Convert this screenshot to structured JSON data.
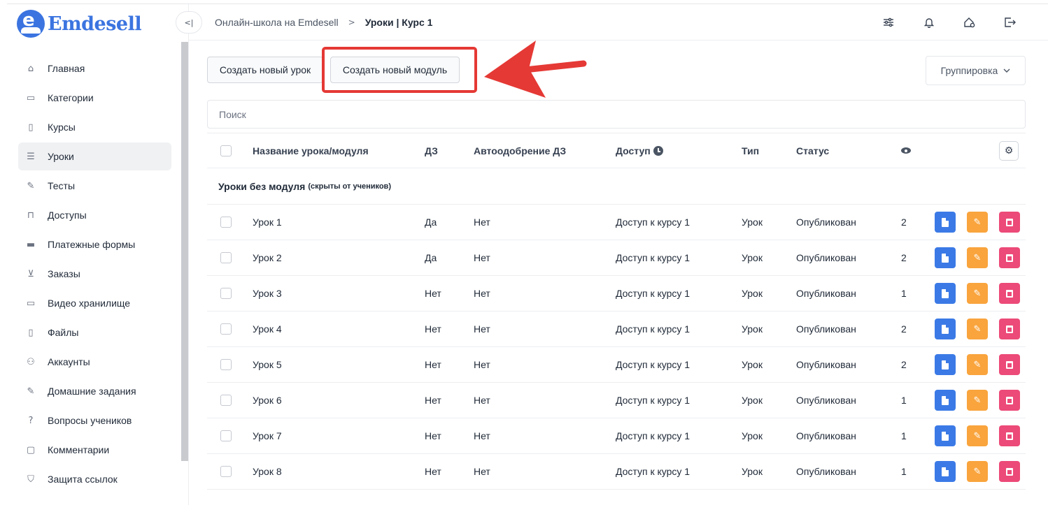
{
  "app": {
    "name": "Emdesell",
    "logo_letter": "e"
  },
  "header": {
    "breadcrumb": [
      "Онлайн-школа на Emdesell",
      "Уроки | Курс 1"
    ],
    "icons": [
      "sliders-icon",
      "bell-icon",
      "home-settings-icon",
      "logout-icon"
    ]
  },
  "sidebar": {
    "items": [
      {
        "label": "Главная",
        "icon": "home-icon",
        "glyph": "⌂"
      },
      {
        "label": "Категории",
        "icon": "folder-icon",
        "glyph": "▭"
      },
      {
        "label": "Курсы",
        "icon": "book-icon",
        "glyph": "▯"
      },
      {
        "label": "Уроки",
        "icon": "list-icon",
        "glyph": "☰",
        "active": true
      },
      {
        "label": "Тесты",
        "icon": "edit-icon",
        "glyph": "✎"
      },
      {
        "label": "Доступы",
        "icon": "lock-icon",
        "glyph": "⊓"
      },
      {
        "label": "Платежные формы",
        "icon": "credit-card-icon",
        "glyph": "▬"
      },
      {
        "label": "Заказы",
        "icon": "cart-icon",
        "glyph": "⊻"
      },
      {
        "label": "Видео хранилище",
        "icon": "video-icon",
        "glyph": "▭"
      },
      {
        "label": "Файлы",
        "icon": "file-icon",
        "glyph": "▯"
      },
      {
        "label": "Аккаунты",
        "icon": "users-icon",
        "glyph": "⚇"
      },
      {
        "label": "Домашние задания",
        "icon": "pencil-icon",
        "glyph": "✎"
      },
      {
        "label": "Вопросы учеников",
        "icon": "question-icon",
        "glyph": "?"
      },
      {
        "label": "Комментарии",
        "icon": "comment-icon",
        "glyph": "▢"
      },
      {
        "label": "Защита ссылок",
        "icon": "shield-icon",
        "glyph": "⛉"
      }
    ]
  },
  "toolbar": {
    "create_lesson": "Создать новый урок",
    "create_module": "Создать новый модуль",
    "grouping": "Группировка"
  },
  "search": {
    "placeholder": "Поиск"
  },
  "table": {
    "columns": {
      "name": "Название урока/модуля",
      "hw": "ДЗ",
      "auto": "Автоодобрение ДЗ",
      "access": "Доступ",
      "type": "Тип",
      "status": "Статус"
    },
    "group": {
      "title": "Уроки без модуля",
      "note": "(скрыты от учеников)"
    },
    "rows": [
      {
        "name": "Урок 1",
        "hw": "Да",
        "auto": "Нет",
        "access": "Доступ к курсу 1",
        "type": "Урок",
        "status": "Опубликован",
        "views": "2"
      },
      {
        "name": "Урок 2",
        "hw": "Да",
        "auto": "Нет",
        "access": "Доступ к курсу 1",
        "type": "Урок",
        "status": "Опубликован",
        "views": "2"
      },
      {
        "name": "Урок 3",
        "hw": "Нет",
        "auto": "Нет",
        "access": "Доступ к курсу 1",
        "type": "Урок",
        "status": "Опубликован",
        "views": "1"
      },
      {
        "name": "Урок 4",
        "hw": "Нет",
        "auto": "Нет",
        "access": "Доступ к курсу 1",
        "type": "Урок",
        "status": "Опубликован",
        "views": "2"
      },
      {
        "name": "Урок 5",
        "hw": "Нет",
        "auto": "Нет",
        "access": "Доступ к курсу 1",
        "type": "Урок",
        "status": "Опубликован",
        "views": "2"
      },
      {
        "name": "Урок 6",
        "hw": "Нет",
        "auto": "Нет",
        "access": "Доступ к курсу 1",
        "type": "Урок",
        "status": "Опубликован",
        "views": "1"
      },
      {
        "name": "Урок 7",
        "hw": "Нет",
        "auto": "Нет",
        "access": "Доступ к курсу 1",
        "type": "Урок",
        "status": "Опубликован",
        "views": "1"
      },
      {
        "name": "Урок 8",
        "hw": "Нет",
        "auto": "Нет",
        "access": "Доступ к курсу 1",
        "type": "Урок",
        "status": "Опубликован",
        "views": "1"
      }
    ]
  },
  "colors": {
    "brand": "#3b74e0",
    "annotation": "#e53935",
    "view": "#3b7ae6",
    "edit": "#f9a43d",
    "delete": "#ec4a78"
  }
}
